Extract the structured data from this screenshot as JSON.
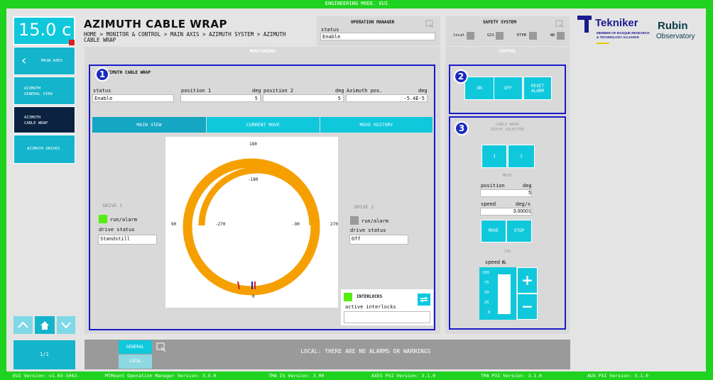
{
  "top_banner": "ENGINEERING MODE. EUI",
  "temperature": "15.0 c",
  "nav": {
    "main_axes": "MAIN AXES",
    "az_general": "AZIMUTH\nGENERAL VIEW",
    "az_cable": "AZIMUTH\nCABLE WRAP",
    "az_drives": "AZIMUTH DRIVES",
    "page": "1/1"
  },
  "header": {
    "title": "AZIMUTH CABLE WRAP",
    "breadcrumb": "HOME > MONITOR & CONTROL > MAIN AXIS > AZIMUTH SYSTEM > AZIMUTH CABLE WRAP"
  },
  "op_manager": {
    "title": "OPERATION MANAGER",
    "status_label": "status",
    "status_value": "Enable"
  },
  "safety": {
    "title": "SAFETY SYSTEM",
    "items": [
      "local",
      "GIS",
      "ETPB",
      "WD"
    ]
  },
  "logos": {
    "tekniker": "Tekniker",
    "tekniker_sub1": "MEMBER OF BASQUE RESEARCH",
    "tekniker_sub2": "& TECHNOLOGY ALLIANCE",
    "rubin1": "Rubin",
    "rubin2": "Observatory"
  },
  "monitoring": {
    "header": "MONITORING",
    "section_title": "AZIMUTH CABLE WRAP",
    "status_label": "status",
    "status_value": "Enable",
    "pos1_label": "position 1",
    "pos1_unit": "deg",
    "pos1_value": "5",
    "pos2_label": "position 2",
    "pos2_unit": "deg",
    "pos2_value": "5",
    "azpos_label": "Azimuth pos.",
    "azpos_unit": "deg",
    "azpos_value": "-5.4E-5",
    "tabs": [
      "MAIN VIEW",
      "CURRENT MOVE",
      "MOVE HISTORY"
    ],
    "drive1": {
      "title": "DRIVE 1",
      "run_label": "run/alarm",
      "status_label": "drive status",
      "status_value": "Standstill"
    },
    "drive2": {
      "title": "DRIVE 2",
      "run_label": "run/alarm",
      "status_label": "drive status",
      "status_value": "Off"
    },
    "dial": {
      "top": "180",
      "bottom": "0",
      "left": "90",
      "right": "270",
      "inner_top": "-180",
      "inner_left": "-270",
      "inner_right": "-90"
    },
    "interlocks": {
      "title": "INTERLOCKS",
      "active_label": "active interlocks"
    }
  },
  "control": {
    "header": "CONTROL",
    "on": "ON",
    "off": "OFF",
    "reset": "RESET\nALARM",
    "cw_title": "CABLE WRAP\nDRIVE SELECTOR",
    "sel1": "1",
    "sel2": "2",
    "move_title": "MOVE",
    "position_label": "position",
    "position_unit": "deg",
    "position_value": "5",
    "speed_label": "speed",
    "speed_unit": "deg/s",
    "speed_value": "3.00001",
    "move_btn": "MOVE",
    "stop_btn": "STOP",
    "jog_title": "JOG",
    "jog_speed_label": "speed %",
    "jog_ticks": [
      "100",
      "75",
      "50",
      "25",
      "0"
    ],
    "jog_level": 1.0
  },
  "footer": {
    "general": "GENERAL",
    "local": "LOCAL",
    "message": "LOCAL: THERE ARE NO ALARMS OR WARNINGS"
  },
  "versions": [
    "EUI Version: v1.03-1042-",
    "MTMount Operation Manager Version: 3.5.0",
    "TMA IS Version: 3.00",
    "AXES PXI Version: 3.1.0",
    "TMA PXI Version: 3.1.0",
    "AUX PXI Version: 3.1.0"
  ],
  "badges": [
    "1",
    "2",
    "3"
  ]
}
